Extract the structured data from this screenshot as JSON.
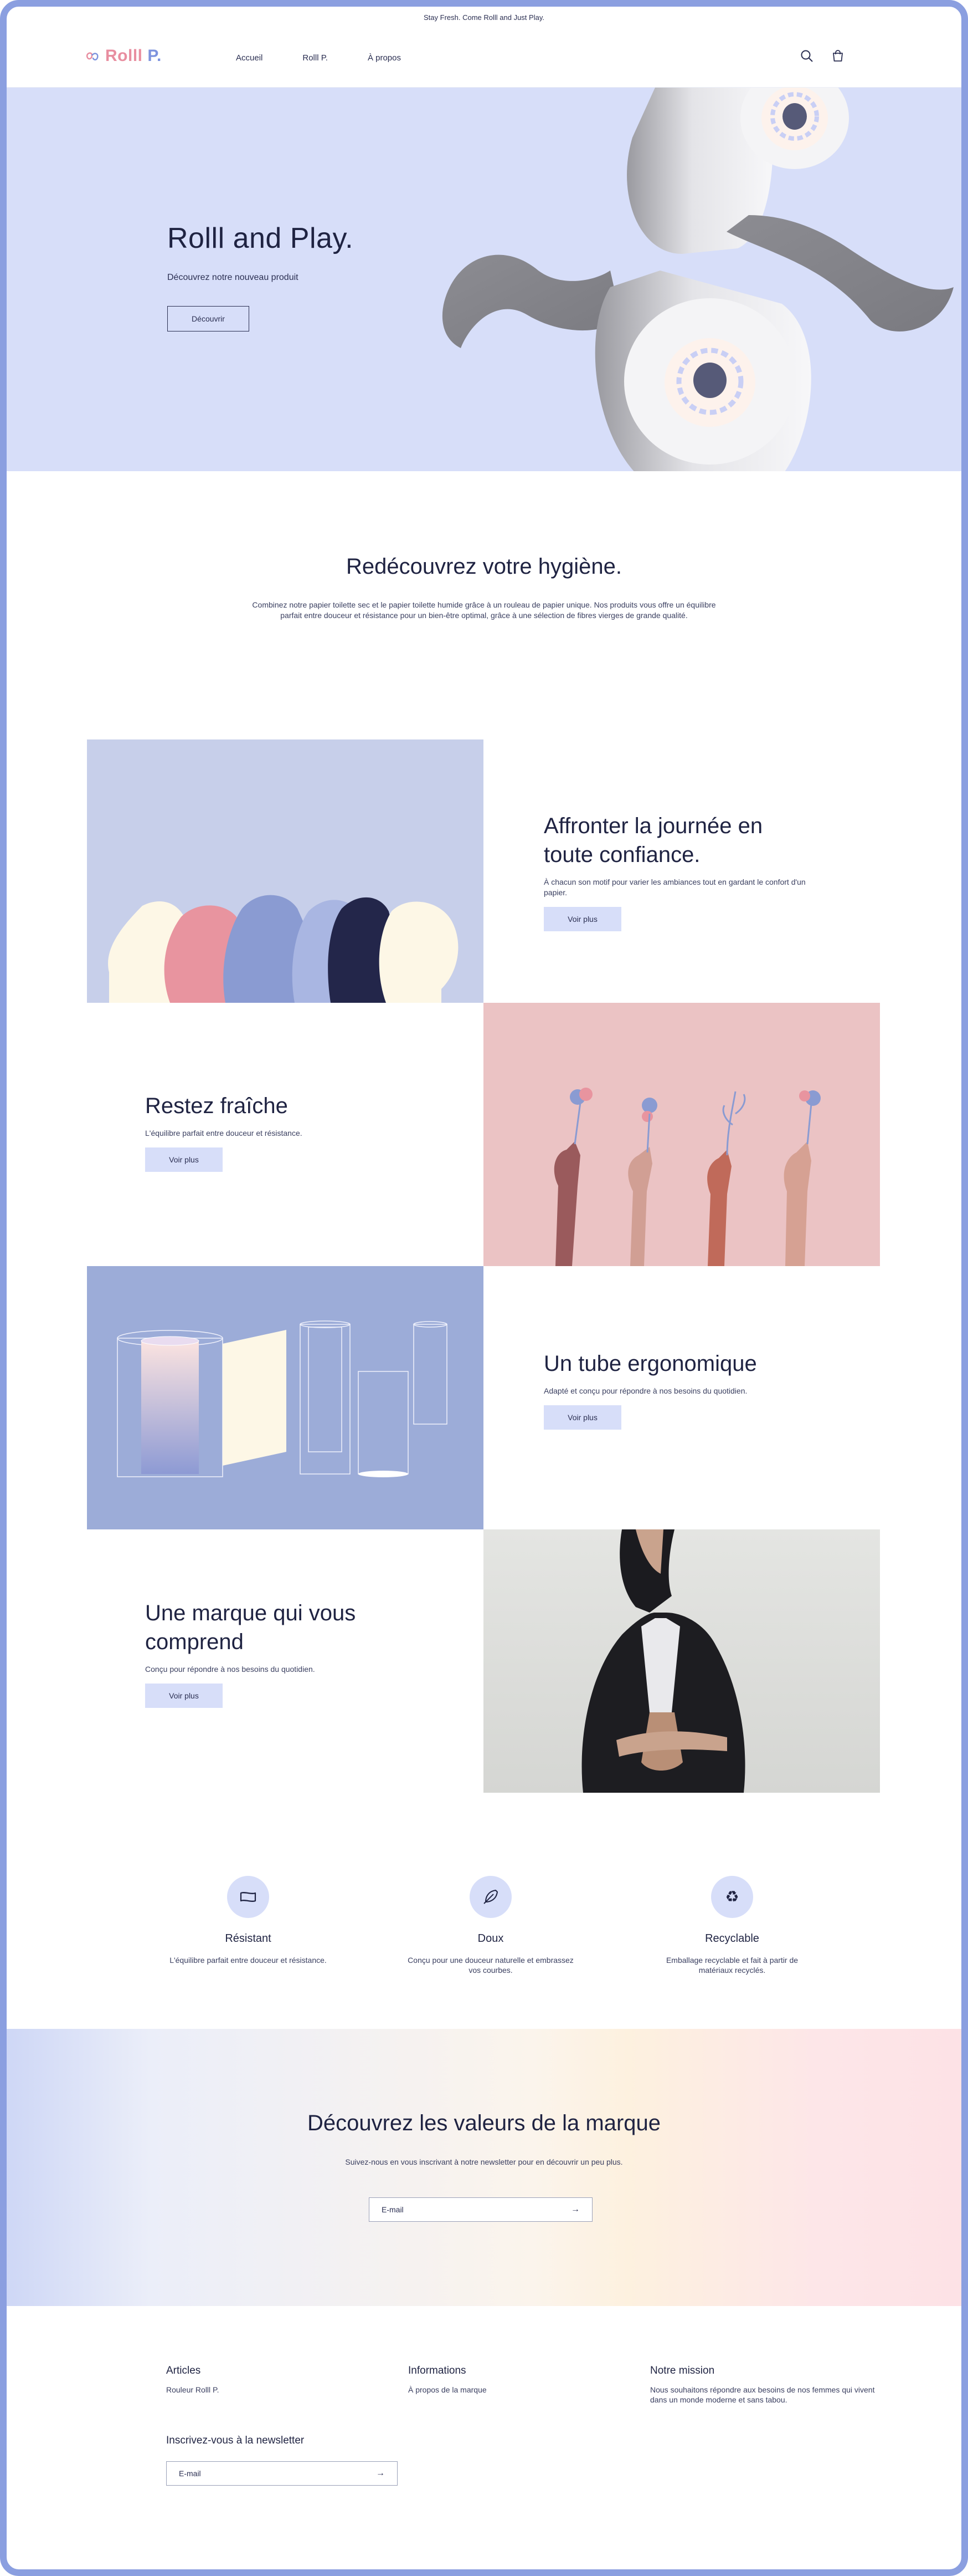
{
  "announcement": "Stay Fresh. Come Rolll and Just Play.",
  "header": {
    "logo_text_part1": "Rolll",
    "logo_text_part2": "P.",
    "nav": [
      "Accueil",
      "Rolll P.",
      "À propos"
    ]
  },
  "hero": {
    "title": "Rolll and Play.",
    "subtitle": "Découvrez notre nouveau produit",
    "button": "Découvrir"
  },
  "intro": {
    "title": "Redécouvrez votre hygiène.",
    "text": "Combinez notre papier toilette sec et le papier toilette humide grâce à un rouleau de papier unique. Nos produits vous offre un équilibre parfait entre douceur et résistance pour un bien-être optimal, grâce à une sélection de fibres vierges de grande qualité."
  },
  "features": [
    {
      "title": "Affronter la journée en toute confiance.",
      "text": "À chacun son motif pour varier les ambiances tout en gardant le confort d'un papier.",
      "button": "Voir plus"
    },
    {
      "title": "Restez fraîche",
      "text": "L'équilibre parfait entre douceur et résistance.",
      "button": "Voir plus"
    },
    {
      "title": "Un tube ergonomique",
      "text": "Adapté et conçu pour répondre à nos besoins du quotidien.",
      "button": "Voir plus"
    },
    {
      "title": "Une marque qui vous comprend",
      "text": "Conçu pour répondre à nos besoins du quotidien.",
      "button": "Voir plus"
    }
  ],
  "benefits": [
    {
      "title": "Résistant",
      "text": "L'équilibre parfait entre douceur et résistance.",
      "icon": "paper-icon"
    },
    {
      "title": "Doux",
      "text": "Conçu pour une douceur naturelle et embrassez vos courbes.",
      "icon": "feather-icon"
    },
    {
      "title": "Recyclable",
      "text": "Emballage recyclable et fait à partir de matériaux recyclés.",
      "icon": "recycle-icon"
    }
  ],
  "newsletter": {
    "title": "Découvrez les valeurs de la marque",
    "text": "Suivez-nous en vous inscrivant à notre newsletter pour en découvrir un peu plus.",
    "placeholder": "E-mail"
  },
  "footer": {
    "col1_title": "Articles",
    "col1_link": "Rouleur Rolll P.",
    "col2_title": "Informations",
    "col2_link": "À propos de la marque",
    "col3_title": "Notre mission",
    "col3_text": "Nous souhaitons répondre aux besoins de nos femmes qui vivent dans un monde moderne et sans tabou.",
    "news_title": "Inscrivez-vous à la newsletter",
    "news_placeholder": "E-mail"
  },
  "colors": {
    "accent": "#d7def9",
    "frame": "#8b9fe0",
    "logo_pink": "#e88ea0",
    "logo_blue": "#7d93de",
    "text": "#1f2342"
  }
}
